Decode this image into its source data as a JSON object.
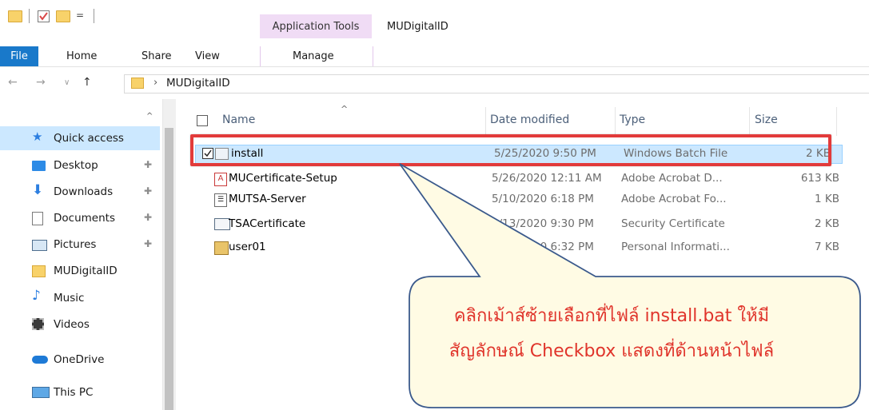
{
  "titlebar": {
    "contextual_tab": "Application Tools",
    "window_title": "MUDigitalID"
  },
  "ribbon": {
    "tabs": [
      "File",
      "Home",
      "Share",
      "View",
      "Manage"
    ]
  },
  "address": {
    "path_separator": "›",
    "current_folder": "MUDigitalID"
  },
  "navpane": {
    "items": [
      {
        "label": "Quick access",
        "icon": "star-icon",
        "pinned": false
      },
      {
        "label": "Desktop",
        "icon": "desktop-icon",
        "pinned": true
      },
      {
        "label": "Downloads",
        "icon": "download-arrow-icon",
        "pinned": true
      },
      {
        "label": "Documents",
        "icon": "document-icon",
        "pinned": true
      },
      {
        "label": "Pictures",
        "icon": "pictures-icon",
        "pinned": true
      },
      {
        "label": "MUDigitalID",
        "icon": "folder-icon",
        "pinned": false
      },
      {
        "label": "Music",
        "icon": "music-note-icon",
        "pinned": false
      },
      {
        "label": "Videos",
        "icon": "film-icon",
        "pinned": false
      },
      {
        "label": "OneDrive",
        "icon": "cloud-icon",
        "pinned": false
      },
      {
        "label": "This PC",
        "icon": "monitor-icon",
        "pinned": false
      }
    ]
  },
  "filelist": {
    "columns": [
      "Name",
      "Date modified",
      "Type",
      "Size"
    ],
    "rows": [
      {
        "name": "install",
        "date": "5/25/2020 9:50 PM",
        "type": "Windows Batch File",
        "size": "2 KB",
        "selected": true,
        "icon": "batch-file-icon"
      },
      {
        "name": "MUCertificate-Setup",
        "date": "5/26/2020 12:11 AM",
        "type": "Adobe Acrobat D...",
        "size": "613 KB",
        "selected": false,
        "icon": "pdf-file-icon"
      },
      {
        "name": "MUTSA-Server",
        "date": "5/10/2020 6:18 PM",
        "type": "Adobe Acrobat Fo...",
        "size": "1 KB",
        "selected": false,
        "icon": "acrobat-form-icon"
      },
      {
        "name": "TSACertificate",
        "date": "5/13/2020 9:30 PM",
        "type": "Security Certificate",
        "size": "2 KB",
        "selected": false,
        "icon": "certificate-icon"
      },
      {
        "name": "user01",
        "date": "5/10/2020 6:32 PM",
        "type": "Personal Informati...",
        "size": "7 KB",
        "selected": false,
        "icon": "personal-info-icon"
      }
    ]
  },
  "callout": {
    "line1": "คลิกเม้าส์ซ้ายเลือกที่ไฟล์ install.bat ให้มี",
    "line2": "สัญลักษณ์ Checkbox แสดงที่ด้านหน้าไฟล์",
    "text_color": "#e0342b",
    "fill_color": "#fffbe4",
    "border_color": "#3b5a8c"
  },
  "colors": {
    "selection": "#cce8ff",
    "highlight_border": "#e23b3b",
    "file_tab": "#1979ca",
    "contextual_tab": "#f0dcf5"
  }
}
